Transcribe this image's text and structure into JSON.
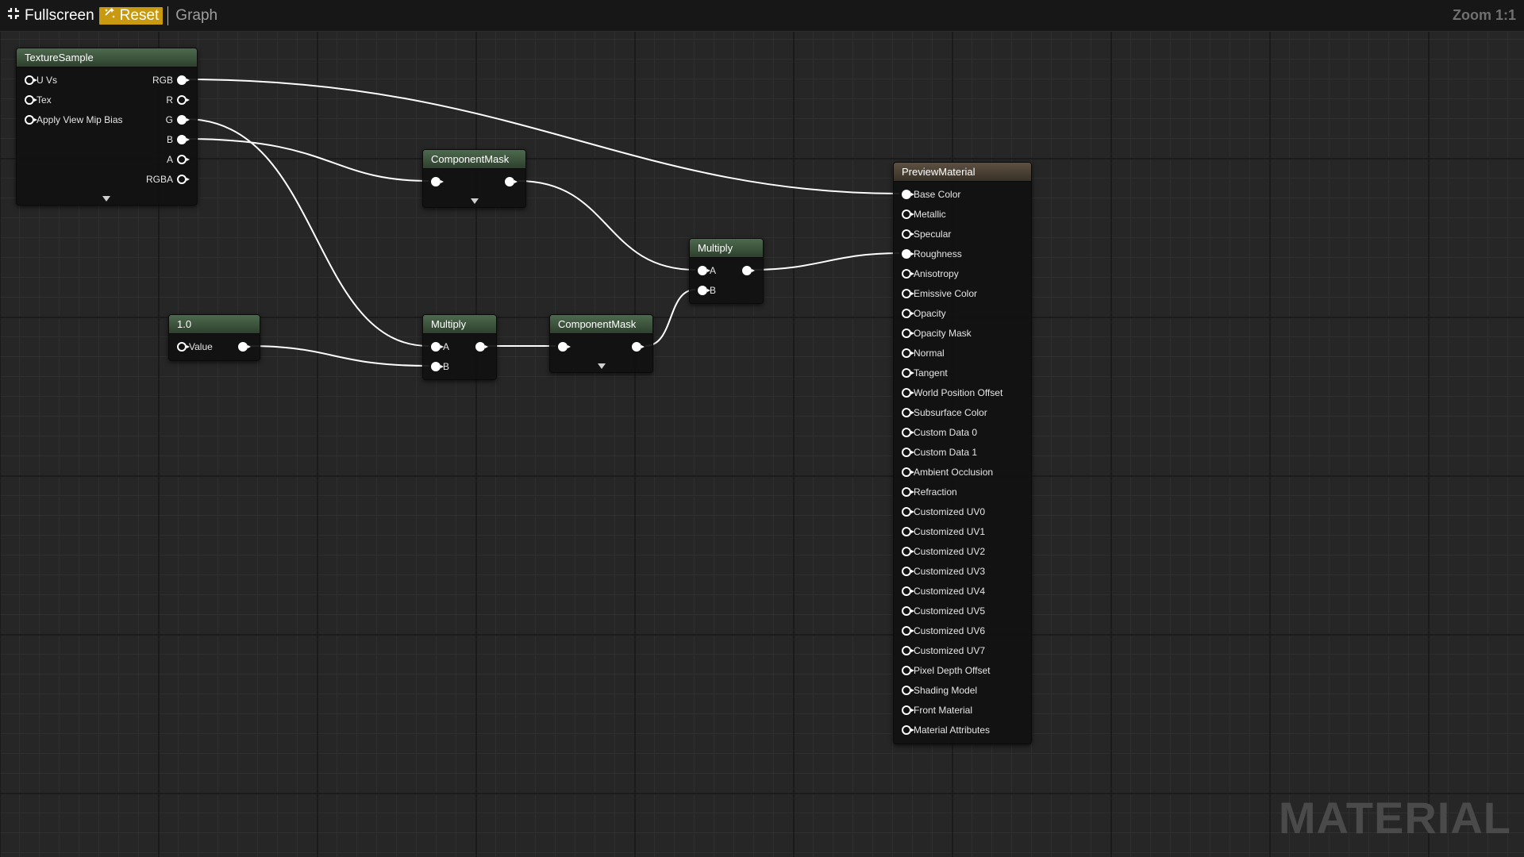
{
  "toolbar": {
    "fullscreen_label": "Fullscreen",
    "reset_label": "Reset",
    "graph_label": "Graph",
    "zoom_label": "Zoom 1:1"
  },
  "watermark": "MATERIAL",
  "colors": {
    "canvas_bg": "#262626",
    "reset_button": "#c99a10",
    "expression_header": "#4d6a4d",
    "preview_header": "#5e5142",
    "wire": "#ffffff"
  },
  "icons": {
    "fullscreen": "collapse-arrows-icon",
    "reset": "reset-sparkle-icon",
    "pin_connected": "filled-circle-pin-icon",
    "pin_unconnected": "hollow-circle-pin-icon",
    "expand": "triangle-down-icon"
  },
  "nodes": {
    "texture_sample": {
      "title": "TextureSample",
      "inputs": [
        "U Vs",
        "Tex",
        "Apply View Mip Bias"
      ],
      "outputs": [
        "RGB",
        "R",
        "G",
        "B",
        "A",
        "RGBA"
      ]
    },
    "component_mask_1": {
      "title": "ComponentMask"
    },
    "multiply_1": {
      "title": "Multiply",
      "inputs": [
        "A",
        "B"
      ]
    },
    "constant": {
      "title": "1.0",
      "inputs": [
        "Value"
      ]
    },
    "multiply_2": {
      "title": "Multiply",
      "inputs": [
        "A",
        "B"
      ]
    },
    "component_mask_2": {
      "title": "ComponentMask"
    },
    "preview_material": {
      "title": "PreviewMaterial",
      "inputs": [
        "Base Color",
        "Metallic",
        "Specular",
        "Roughness",
        "Anisotropy",
        "Emissive Color",
        "Opacity",
        "Opacity Mask",
        "Normal",
        "Tangent",
        "World Position Offset",
        "Subsurface Color",
        "Custom Data 0",
        "Custom Data 1",
        "Ambient Occlusion",
        "Refraction",
        "Customized UV0",
        "Customized UV1",
        "Customized UV2",
        "Customized UV3",
        "Customized UV4",
        "Customized UV5",
        "Customized UV6",
        "Customized UV7",
        "Pixel Depth Offset",
        "Shading Model",
        "Front Material",
        "Material Attributes"
      ]
    }
  }
}
